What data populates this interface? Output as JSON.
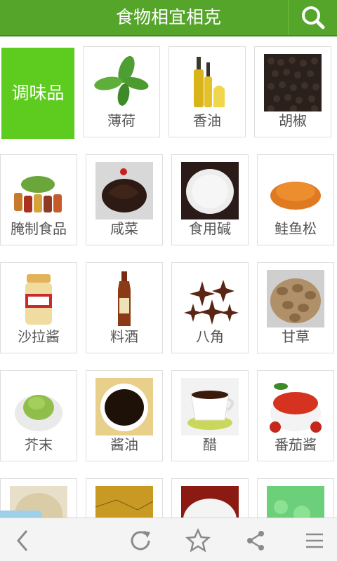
{
  "header": {
    "title": "食物相宜相克",
    "search_icon": "search-icon"
  },
  "category": {
    "label": "调味品"
  },
  "items": [
    {
      "label": "薄荷"
    },
    {
      "label": "香油"
    },
    {
      "label": "胡椒"
    },
    {
      "label": "腌制食品"
    },
    {
      "label": "咸菜"
    },
    {
      "label": "食用碱"
    },
    {
      "label": "鲑鱼松"
    },
    {
      "label": "沙拉酱"
    },
    {
      "label": "料酒"
    },
    {
      "label": "八角"
    },
    {
      "label": "甘草"
    },
    {
      "label": "芥末"
    },
    {
      "label": "酱油"
    },
    {
      "label": "醋"
    },
    {
      "label": "番茄酱"
    },
    {
      "label": ""
    },
    {
      "label": ""
    },
    {
      "label": ""
    },
    {
      "label": ""
    }
  ],
  "bottom_bar": {
    "icons": [
      "back-icon",
      "refresh-icon",
      "star-icon",
      "share-icon",
      "menu-icon"
    ]
  },
  "colors": {
    "header": "#55a52a",
    "category": "#5ecc1e"
  }
}
